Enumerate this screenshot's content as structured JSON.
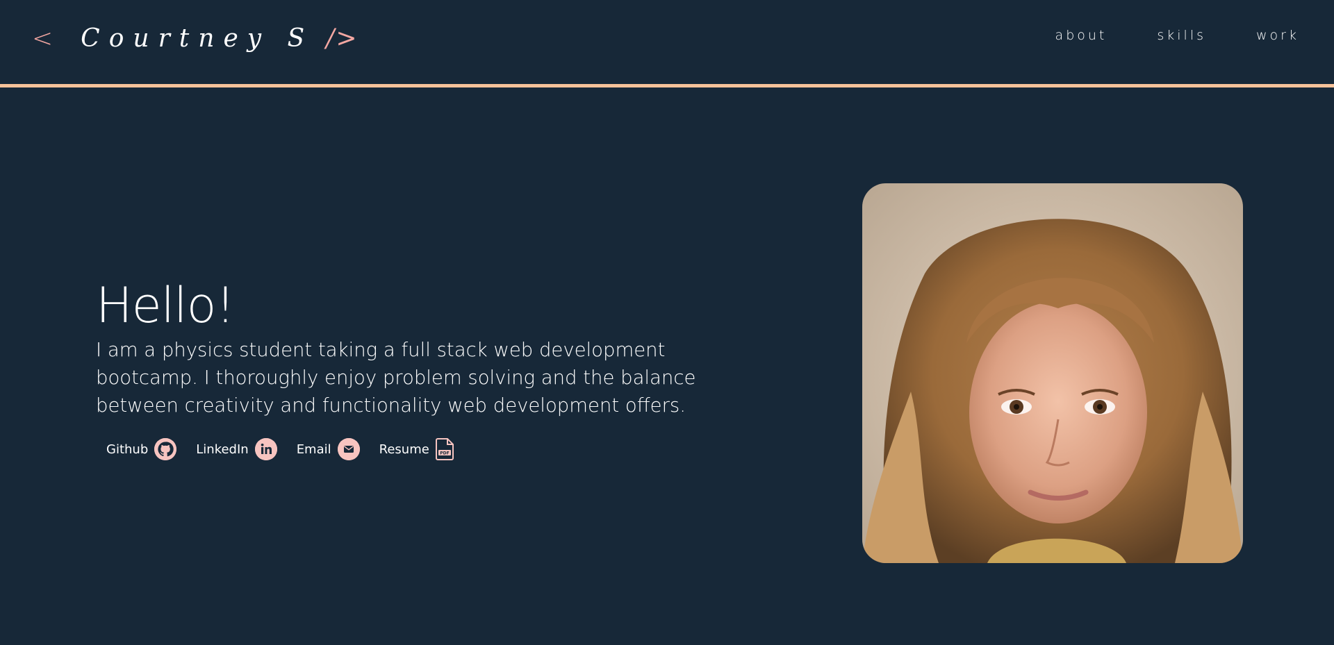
{
  "header": {
    "logo": {
      "open_bracket": "<",
      "name": "Courtney S",
      "close_bracket": "/>"
    },
    "nav": [
      {
        "label": "about"
      },
      {
        "label": "skills"
      },
      {
        "label": "work"
      }
    ]
  },
  "hero": {
    "greeting": "Hello!",
    "intro": "I am a physics student taking a full stack web development bootcamp. I thoroughly enjoy problem solving and the balance between creativity and functionality web development offers.",
    "links": [
      {
        "label": "Github",
        "icon": "github-icon"
      },
      {
        "label": "LinkedIn",
        "icon": "linkedin-icon"
      },
      {
        "label": "Email",
        "icon": "email-icon"
      },
      {
        "label": "Resume",
        "icon": "pdf-icon"
      }
    ]
  },
  "colors": {
    "background": "#172838",
    "accent_border": "#f7c29a",
    "accent_pink": "#f3a7a2",
    "icon_fill": "#f7c4c0"
  }
}
